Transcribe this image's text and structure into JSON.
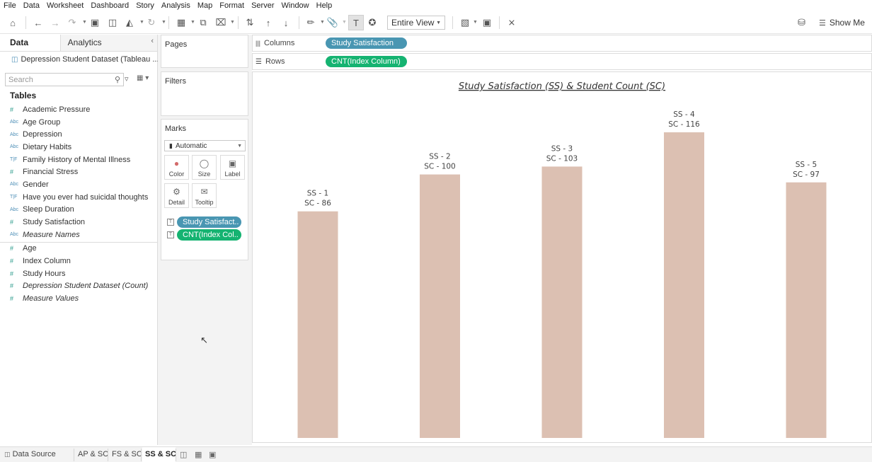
{
  "menu": [
    "File",
    "Data",
    "Worksheet",
    "Dashboard",
    "Story",
    "Analysis",
    "Map",
    "Format",
    "Server",
    "Window",
    "Help"
  ],
  "toolbar": {
    "view_select": "Entire View",
    "show_me": "Show Me"
  },
  "data_pane": {
    "tab_data": "Data",
    "tab_analytics": "Analytics",
    "datasource": "Depression Student Dataset (Tableau ...",
    "search_placeholder": "Search",
    "tables_title": "Tables",
    "fields": [
      {
        "type": "#",
        "name": "Academic Pressure",
        "italic": false
      },
      {
        "type": "Abc",
        "name": "Age Group",
        "italic": false
      },
      {
        "type": "Abc",
        "name": "Depression",
        "italic": false
      },
      {
        "type": "Abc",
        "name": "Dietary Habits",
        "italic": false
      },
      {
        "type": "T|F",
        "name": "Family History of Mental Illness",
        "italic": false
      },
      {
        "type": "#",
        "name": "Financial Stress",
        "italic": false
      },
      {
        "type": "Abc",
        "name": "Gender",
        "italic": false
      },
      {
        "type": "T|F",
        "name": "Have you ever had suicidal thoughts",
        "italic": false
      },
      {
        "type": "Abc",
        "name": "Sleep Duration",
        "italic": false
      },
      {
        "type": "#",
        "name": "Study Satisfaction",
        "italic": false
      },
      {
        "type": "Abc",
        "name": "Measure Names",
        "italic": true
      },
      {
        "type": "#",
        "name": "Age",
        "italic": false
      },
      {
        "type": "#",
        "name": "Index Column",
        "italic": false
      },
      {
        "type": "#",
        "name": "Study Hours",
        "italic": false
      },
      {
        "type": "#",
        "name": "Depression Student Dataset (Count)",
        "italic": true
      },
      {
        "type": "#",
        "name": "Measure Values",
        "italic": true
      }
    ]
  },
  "cards": {
    "pages": "Pages",
    "filters": "Filters",
    "marks": "Marks",
    "marks_type": "Automatic",
    "mark_buttons": [
      "Color",
      "Size",
      "Label",
      "Detail",
      "Tooltip"
    ],
    "mark_pills": [
      "Study Satisfact..",
      "CNT(Index Col.."
    ]
  },
  "shelves": {
    "columns_label": "Columns",
    "columns_pill": "Study Satisfaction",
    "rows_label": "Rows",
    "rows_pill": "CNT(Index Column)"
  },
  "chart_data": {
    "type": "bar",
    "title": "Study Satisfaction (SS) & Student Count (SC)",
    "categories": [
      "1",
      "2",
      "3",
      "4",
      "5"
    ],
    "values": [
      86,
      100,
      103,
      116,
      97
    ],
    "labels": [
      [
        "SS - 1",
        "SC - 86"
      ],
      [
        "SS - 2",
        "SC - 100"
      ],
      [
        "SS - 3",
        "SC - 103"
      ],
      [
        "SS - 4",
        "SC - 116"
      ],
      [
        "SS - 5",
        "SC - 97"
      ]
    ],
    "ylim": [
      0,
      116
    ],
    "bar_color": "#dcc0b2",
    "grid": false
  },
  "sheet_tabs": {
    "data_source": "Data Source",
    "sheets": [
      "AP & SC",
      "FS & SC",
      "SS & SC"
    ],
    "active": "SS & SC"
  },
  "colors": {
    "pill_dimension": "#4996b2",
    "pill_measure": "#15b371"
  }
}
